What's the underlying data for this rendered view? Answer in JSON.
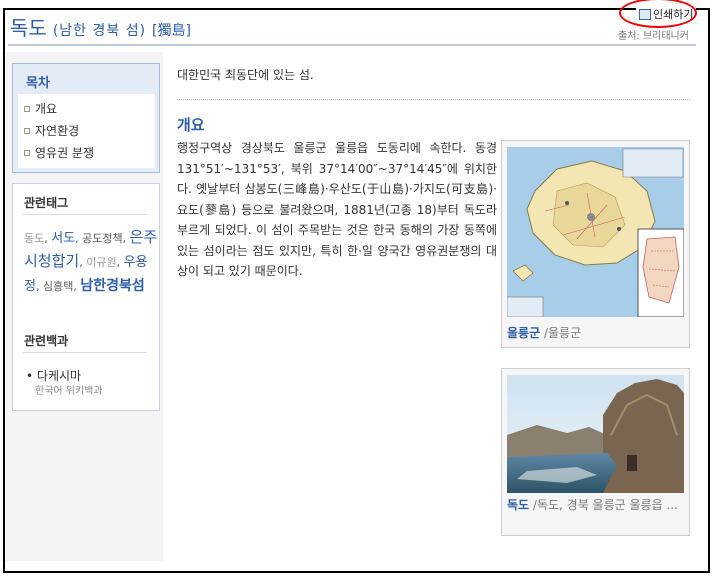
{
  "header": {
    "title": "독도",
    "subtitle": "(남한 경북 섬)",
    "hanja": "[獨島]",
    "print_label": "인쇄하기",
    "source": "출처: 브리태니커"
  },
  "toc": {
    "title": "목차",
    "items": [
      "개요",
      "자연환경",
      "영유권 분쟁"
    ]
  },
  "tags": {
    "title": "관련태그",
    "items": [
      {
        "text": "동도",
        "color": "#999999",
        "size": 11,
        "bold": false
      },
      {
        "text": "서도",
        "color": "#2e5ea8",
        "size": 13,
        "bold": false
      },
      {
        "text": "공도정책",
        "color": "#555555",
        "size": 11,
        "bold": false
      },
      {
        "text": "은주시청합기",
        "color": "#2e5ea8",
        "size": 15,
        "bold": false
      },
      {
        "text": "이규원",
        "color": "#999999",
        "size": 11,
        "bold": false
      },
      {
        "text": "우용정",
        "color": "#2e5ea8",
        "size": 13,
        "bold": false
      },
      {
        "text": "심흥택",
        "color": "#555555",
        "size": 11,
        "bold": false
      },
      {
        "text": "남한경북섬",
        "color": "#2e5ea8",
        "size": 14,
        "bold": true
      }
    ],
    "related_title": "관련백과",
    "related_item": "다케시마",
    "related_sub": "한국어 위키백과"
  },
  "main": {
    "intro": "대한민국 최동단에 있는 섬.",
    "section_title": "개요",
    "body": "행정구역상 경상북도 울릉군 울릉읍 도동리에 속한다. 동경 131°51′~131°53′, 북위 37°14′00″~37°14′45″에 위치한다. 옛날부터 삼봉도(三峰島)·우산도(于山島)·가지도(可支島)·요도(蓼島) 등으로 불려왔으며, 1881년(고종 18)부터 독도라 부르게 되었다. 이 섬이 주목받는 것은 한국 동해의 가장 동쪽에 있는 섬이라는 점도 있지만, 특히 한·일 양국간 영유권분쟁의 대상이 되고 있기 때문이다."
  },
  "images": {
    "map_caption_link": "울릉군",
    "map_caption_rest": " /울릉군",
    "photo_caption_link": "독도",
    "photo_caption_rest": " /독도, 경북 울릉군 울릉읍 ..."
  },
  "colors": {
    "accent": "#2e5ea8",
    "print_highlight": "#ee0000"
  },
  "icons": {
    "print": "printer-icon"
  }
}
